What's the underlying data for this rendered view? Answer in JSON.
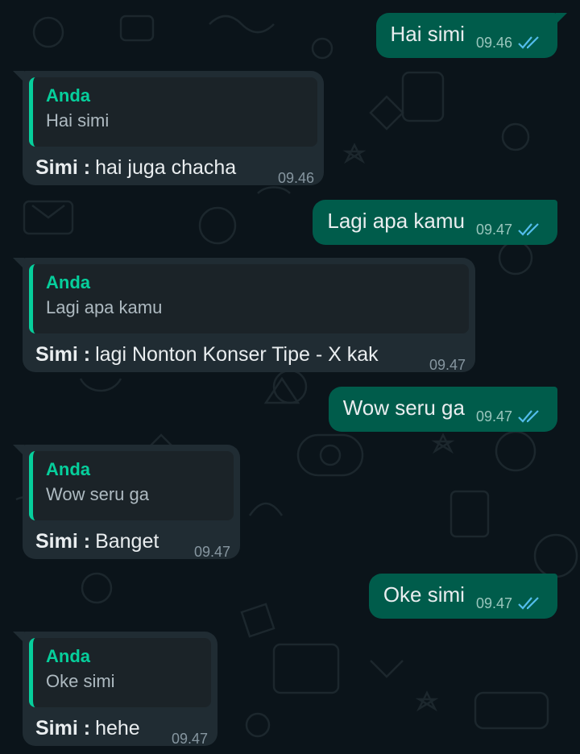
{
  "colors": {
    "background": "#0b141a",
    "outgoing_bubble": "#005c4b",
    "incoming_bubble": "#202c33",
    "quote_accent": "#06cf9c",
    "read_ticks": "#53bdeb"
  },
  "messages": [
    {
      "type": "outgoing",
      "text": "Hai simi",
      "time": "09.46",
      "status_icon": "double-check-icon"
    },
    {
      "type": "incoming",
      "quote_author": "Anda",
      "quote_text": "Hai simi",
      "sender": "Simi :",
      "text": "hai juga chacha",
      "time": "09.46"
    },
    {
      "type": "outgoing",
      "text": "Lagi apa kamu",
      "time": "09.47",
      "status_icon": "double-check-icon"
    },
    {
      "type": "incoming",
      "quote_author": "Anda",
      "quote_text": "Lagi apa kamu",
      "sender": "Simi :",
      "text": "lagi Nonton Konser Tipe - X kak",
      "time": "09.47"
    },
    {
      "type": "outgoing",
      "text": "Wow seru ga",
      "time": "09.47",
      "status_icon": "double-check-icon"
    },
    {
      "type": "incoming",
      "quote_author": "Anda",
      "quote_text": "Wow seru ga",
      "sender": "Simi :",
      "text": "Banget",
      "time": "09.47"
    },
    {
      "type": "outgoing",
      "text": "Oke simi",
      "time": "09.47",
      "status_icon": "double-check-icon"
    },
    {
      "type": "incoming",
      "quote_author": "Anda",
      "quote_text": "Oke simi",
      "sender": "Simi :",
      "text": "hehe",
      "time": "09.47"
    }
  ]
}
